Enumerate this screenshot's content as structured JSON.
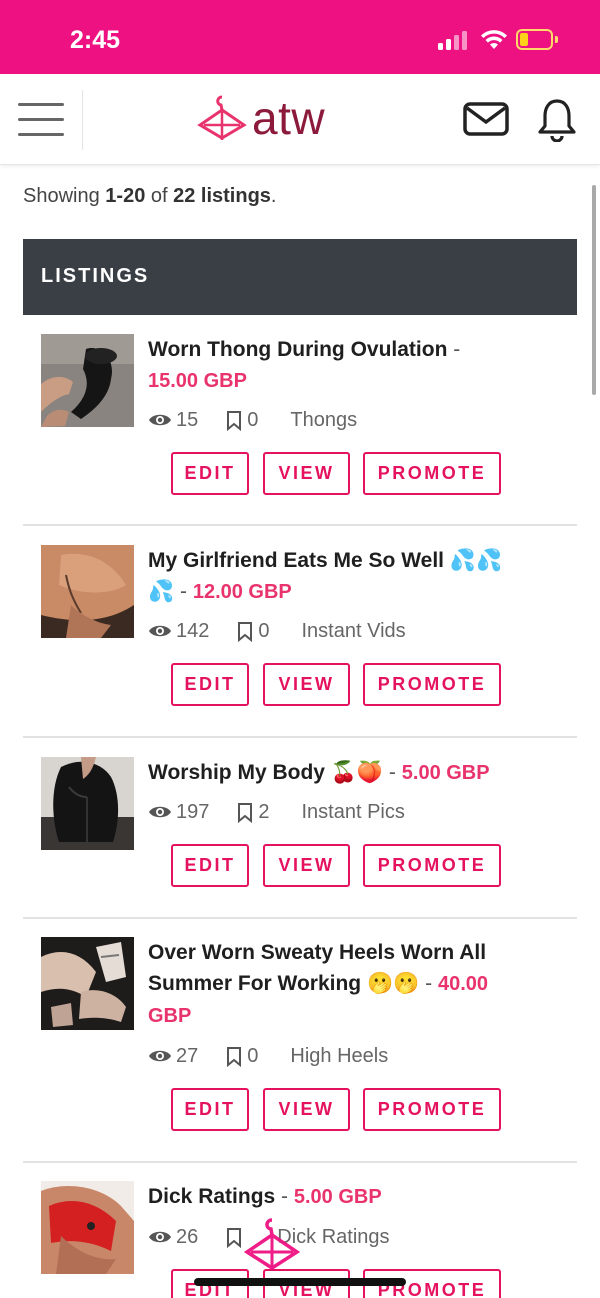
{
  "status_bar": {
    "time": "2:45",
    "accent_color": "#ee1181",
    "battery_color": "#ffd21a"
  },
  "header": {
    "logo_text": "atw",
    "logo_color": "#8b1a3b",
    "icons": [
      "menu-icon",
      "hanger-logo-icon",
      "mail-icon",
      "bell-icon"
    ]
  },
  "summary": {
    "prefix": "Showing ",
    "range": "1-20",
    "of": " of ",
    "count": "22 listings",
    "suffix": "."
  },
  "section": {
    "title": "LISTINGS"
  },
  "colors": {
    "price": "#e8336d",
    "button": "#e5125f",
    "section_bar": "#3a3e45"
  },
  "buttons": {
    "edit": "EDIT",
    "view": "VIEW",
    "promote": "PROMOTE"
  },
  "listings": [
    {
      "title_line1": "Worn Thong During Ovulation",
      "title_line2": "",
      "dash": " -",
      "price": "15.00 GBP",
      "views": "15",
      "saves": "0",
      "category": "Thongs"
    },
    {
      "title_line1": "My Girlfriend Eats Me So Well 💦💦",
      "title_line2": "💦",
      "dash": " - ",
      "price": "12.00 GBP",
      "views": "142",
      "saves": "0",
      "category": "Instant Vids"
    },
    {
      "title_line1": "Worship My Body 🍒🍑",
      "title_line2": "",
      "dash": " - ",
      "price": "5.00 GBP",
      "views": "197",
      "saves": "2",
      "category": "Instant Pics"
    },
    {
      "title_line1": "Over Worn Sweaty Heels Worn All",
      "title_line2": "Summer For Working 🫢🫢",
      "dash": " - ",
      "price_part1": "40.00",
      "price_part2": "GBP",
      "views": "27",
      "saves": "0",
      "category": "High Heels"
    },
    {
      "title_line1": "Dick Ratings",
      "title_line2": "",
      "dash": " - ",
      "price": "5.00 GBP",
      "views": "26",
      "saves": "",
      "category": "Dick Ratings"
    }
  ]
}
